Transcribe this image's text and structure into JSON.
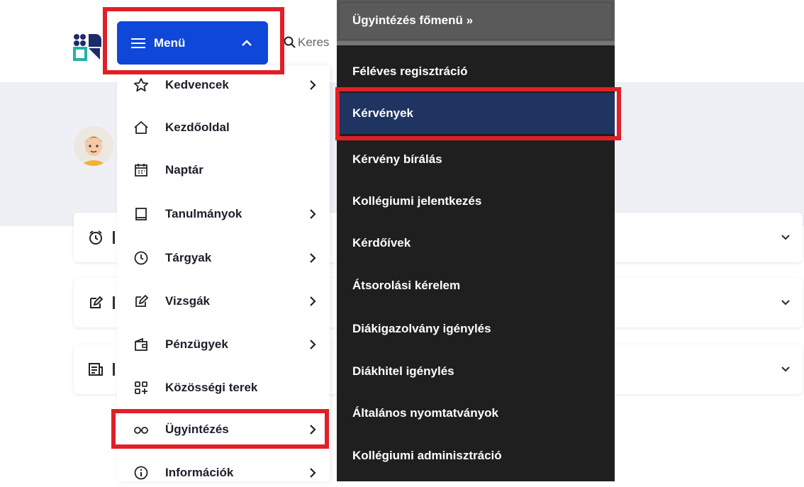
{
  "header": {
    "menu_button_label": "Menü",
    "search_text": "Keres"
  },
  "left_menu": {
    "items": [
      {
        "label": "Kedvencek",
        "icon": "star-icon",
        "has_arrow": true
      },
      {
        "label": "Kezdőoldal",
        "icon": "home-icon",
        "has_arrow": false
      },
      {
        "label": "Naptár",
        "icon": "calendar-icon",
        "has_arrow": false
      },
      {
        "label": "Tanulmányok",
        "icon": "book-icon",
        "has_arrow": true
      },
      {
        "label": "Tárgyak",
        "icon": "clock-icon",
        "has_arrow": true
      },
      {
        "label": "Vizsgák",
        "icon": "edit-icon",
        "has_arrow": true
      },
      {
        "label": "Pénzügyek",
        "icon": "wallet-icon",
        "has_arrow": true
      },
      {
        "label": "Közösségi terek",
        "icon": "grid-plus-icon",
        "has_arrow": false
      },
      {
        "label": "Ügyintézés",
        "icon": "glasses-icon",
        "has_arrow": true
      },
      {
        "label": "Információk",
        "icon": "info-icon",
        "has_arrow": true
      }
    ]
  },
  "sub_menu": {
    "header": "Ügyintézés főmenü »",
    "items": [
      {
        "label": "Féléves regisztráció"
      },
      {
        "label": "Kérvények",
        "active": true
      },
      {
        "label": "Kérvény bírálás"
      },
      {
        "label": "Kollégiumi jelentkezés"
      },
      {
        "label": "Kérdőívek"
      },
      {
        "label": "Átsorolási kérelem"
      },
      {
        "label": "Diákigazolvány igénylés"
      },
      {
        "label": "Diákhitel igénylés"
      },
      {
        "label": "Általános nyomtatványok"
      },
      {
        "label": "Kollégiumi adminisztráció"
      }
    ]
  },
  "colors": {
    "primary": "#0f47d8",
    "highlight": "#e11f26",
    "submenu_bg": "#1f1f1f",
    "submenu_active": "#1f3461"
  }
}
